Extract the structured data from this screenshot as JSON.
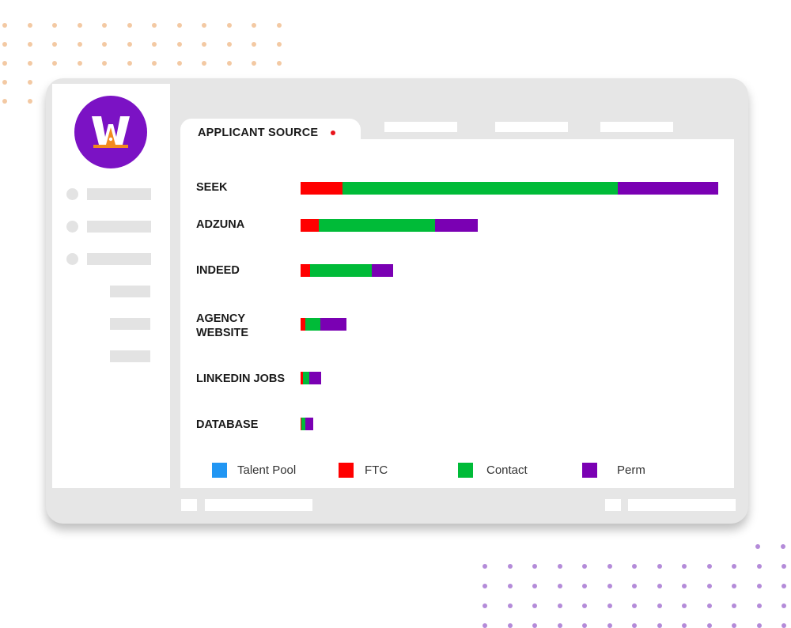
{
  "app": {
    "logo_letter": "W",
    "colors": {
      "brand": "#7b12c4",
      "accent": "#f28a1e"
    }
  },
  "tabs": [
    {
      "label": "APPLICANT SOURCE",
      "active": true,
      "indicator": "red-dot"
    },
    {
      "label": "",
      "active": false
    },
    {
      "label": "",
      "active": false
    },
    {
      "label": "",
      "active": false
    }
  ],
  "chart_data": {
    "type": "bar",
    "orientation": "horizontal",
    "stacked": true,
    "title": "APPLICANT SOURCE",
    "xlabel": "",
    "ylabel": "",
    "grid": false,
    "legend_position": "bottom",
    "categories": [
      "SEEK",
      "ADZUNA",
      "INDEED",
      "AGENCY WEBSITE",
      "LINKEDIN JOBS",
      "DATABASE"
    ],
    "series": [
      {
        "name": "Talent Pool",
        "color": "#2196f3",
        "values": [
          0,
          0,
          0,
          0,
          0,
          0
        ]
      },
      {
        "name": "FTC",
        "color": "#ff0000",
        "values": [
          53,
          23,
          12,
          6,
          3,
          1
        ]
      },
      {
        "name": "Contact",
        "color": "#00bb38",
        "values": [
          348,
          147,
          78,
          19,
          8,
          5
        ]
      },
      {
        "name": "Perm",
        "color": "#7a00b3",
        "values": [
          127,
          54,
          27,
          33,
          15,
          10
        ]
      }
    ],
    "xlim": [
      0,
      528
    ]
  },
  "legend": [
    {
      "label": "Talent Pool",
      "color": "#2196f3"
    },
    {
      "label": "FTC",
      "color": "#ff0000"
    },
    {
      "label": "Contact",
      "color": "#00bb38"
    },
    {
      "label": "Perm",
      "color": "#7a00b3"
    }
  ]
}
